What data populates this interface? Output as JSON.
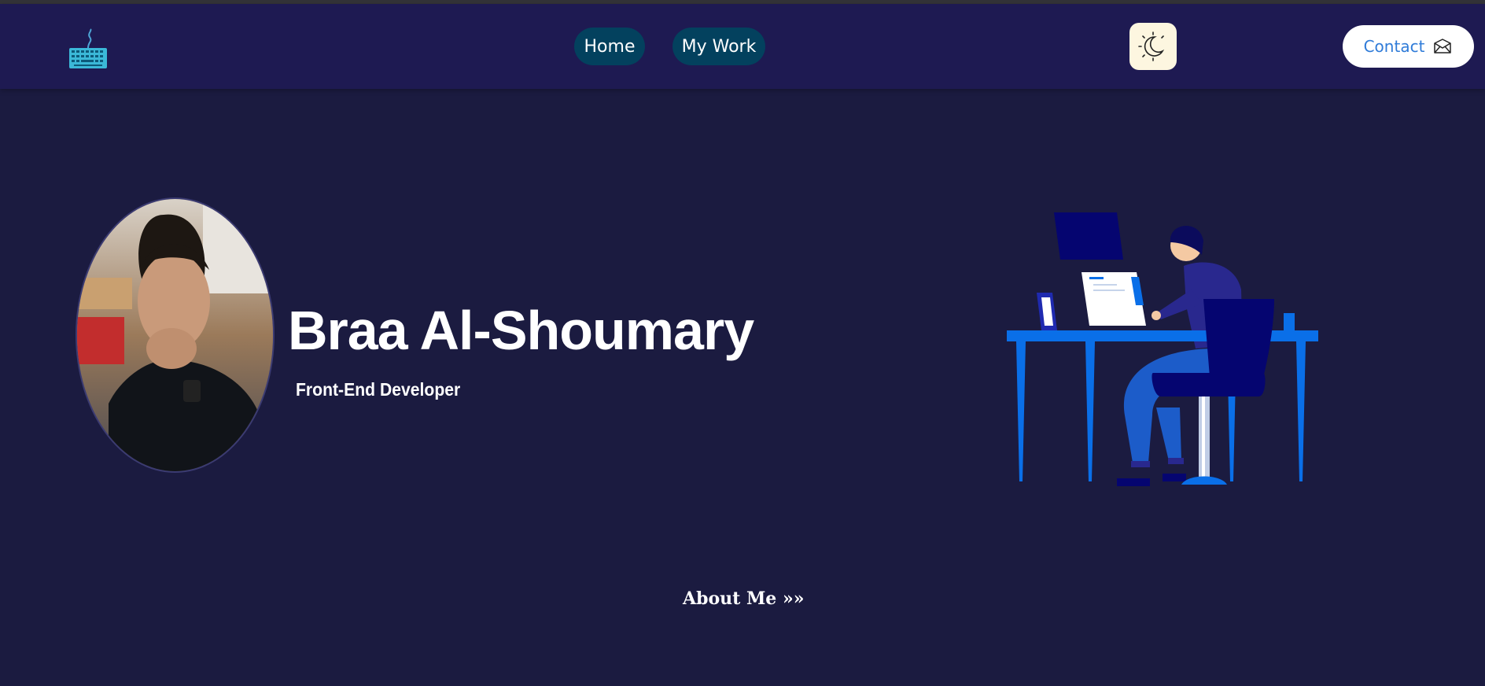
{
  "nav": {
    "logo_icon": "keyboard-icon",
    "links": [
      {
        "label": "Home"
      },
      {
        "label": "My Work"
      }
    ],
    "theme_icon": "sun-moon-icon",
    "contact": {
      "label": "Contact",
      "icon": "envelope-icon"
    }
  },
  "hero": {
    "name": "Braa Al-Shoumary",
    "role": "Front-End Developer",
    "illustration": "developer-at-desk-illustration"
  },
  "about": {
    "label": "About Me »»"
  },
  "colors": {
    "page_bg": "#1b1b40",
    "nav_bg": "#1e1a52",
    "pill_bg": "#03415e",
    "toggle_bg": "#fdf6e0",
    "accent_blue": "#0a6fe8",
    "contact_text": "#2f7bd8"
  }
}
